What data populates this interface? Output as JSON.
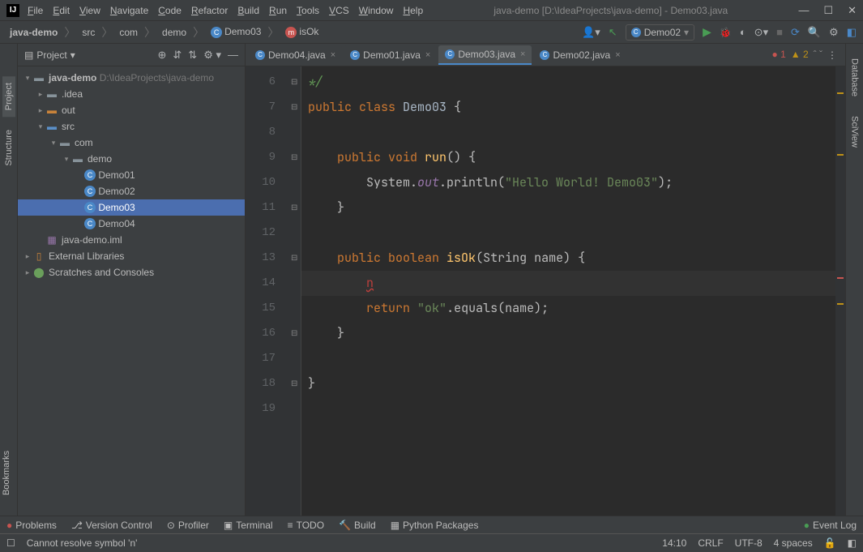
{
  "window": {
    "title": "java-demo [D:\\IdeaProjects\\java-demo] - Demo03.java"
  },
  "menu": [
    "File",
    "Edit",
    "View",
    "Navigate",
    "Code",
    "Refactor",
    "Build",
    "Run",
    "Tools",
    "VCS",
    "Window",
    "Help"
  ],
  "breadcrumb": {
    "items": [
      "java-demo",
      "src",
      "com",
      "demo",
      "Demo03",
      "isOk"
    ]
  },
  "runconfig": "Demo02",
  "leftTabs": [
    "Project",
    "Structure"
  ],
  "rightTabs": [
    "Database",
    "SciView"
  ],
  "bookmarksTab": "Bookmarks",
  "projectPanel": {
    "title": "Project"
  },
  "tree": {
    "root": "java-demo",
    "rootPath": "D:\\IdeaProjects\\java-demo",
    "idea": ".idea",
    "out": "out",
    "src": "src",
    "com": "com",
    "demo": "demo",
    "files": [
      "Demo01",
      "Demo02",
      "Demo03",
      "Demo04"
    ],
    "iml": "java-demo.iml",
    "extlib": "External Libraries",
    "scratches": "Scratches and Consoles"
  },
  "tabs": [
    "Demo04.java",
    "Demo01.java",
    "Demo03.java",
    "Demo02.java"
  ],
  "activeTabIndex": 2,
  "code": {
    "startLine": 6,
    "lines": [
      {
        "n": 6,
        "html": "<span class='com'>*/</span>"
      },
      {
        "n": 7,
        "html": "<span class='kw'>public class</span> <span class='cls'>Demo03</span> {"
      },
      {
        "n": 8,
        "html": ""
      },
      {
        "n": 9,
        "html": "    <span class='kw'>public void</span> <span class='mth'>run</span>() {"
      },
      {
        "n": 10,
        "html": "        System.<span class='field'>out</span>.println(<span class='str'>\"Hello World! Demo03\"</span>);"
      },
      {
        "n": 11,
        "html": "    }"
      },
      {
        "n": 12,
        "html": ""
      },
      {
        "n": 13,
        "html": "    <span class='kw'>public boolean</span> <span class='mth'>isOk</span>(String name) {"
      },
      {
        "n": 14,
        "html": "        <span class='err'>n</span>",
        "current": true
      },
      {
        "n": 15,
        "html": "        <span class='kw'>return</span> <span class='str'>\"ok\"</span>.equals(name);"
      },
      {
        "n": 16,
        "html": "    }"
      },
      {
        "n": 17,
        "html": ""
      },
      {
        "n": 18,
        "html": "}"
      },
      {
        "n": 19,
        "html": ""
      }
    ]
  },
  "inspections": {
    "errors": "1",
    "warnings": "2"
  },
  "bottomTools": [
    "Problems",
    "Version Control",
    "Profiler",
    "Terminal",
    "TODO",
    "Build",
    "Python Packages"
  ],
  "eventLog": "Event Log",
  "status": {
    "message": "Cannot resolve symbol 'n'",
    "pos": "14:10",
    "le": "CRLF",
    "enc": "UTF-8",
    "indent": "4 spaces"
  }
}
